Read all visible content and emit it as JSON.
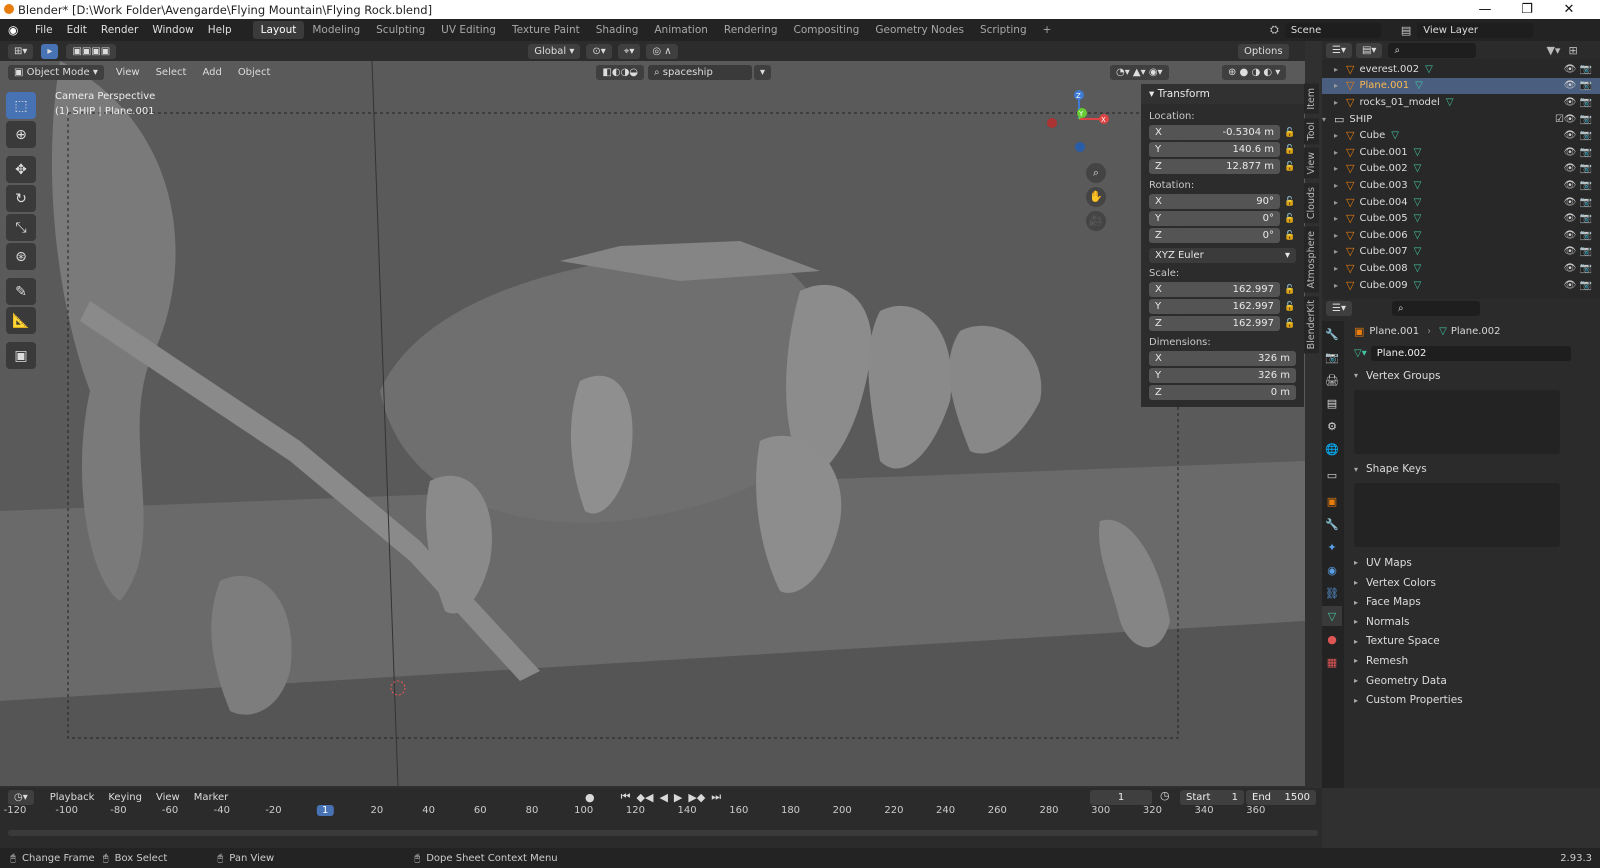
{
  "window": {
    "title": "Blender* [D:\\Work Folder\\Avengarde\\Flying Mountain\\Flying Rock.blend]",
    "min": "—",
    "max": "❐",
    "close": "✕"
  },
  "menu": [
    "File",
    "Edit",
    "Render",
    "Window",
    "Help"
  ],
  "workspaces": [
    {
      "label": "Layout",
      "active": true
    },
    {
      "label": "Modeling"
    },
    {
      "label": "Sculpting"
    },
    {
      "label": "UV Editing"
    },
    {
      "label": "Texture Paint"
    },
    {
      "label": "Shading"
    },
    {
      "label": "Animation"
    },
    {
      "label": "Rendering"
    },
    {
      "label": "Compositing"
    },
    {
      "label": "Geometry Nodes"
    },
    {
      "label": "Scripting"
    }
  ],
  "add_workspace": "+",
  "scene": "Scene",
  "view_layer": "View Layer",
  "viewport_header": {
    "orientation": "Global",
    "options": "Options",
    "mode": "Object Mode",
    "menus": [
      "View",
      "Select",
      "Add",
      "Object"
    ],
    "search_value": "spaceship"
  },
  "viewport": {
    "camera_label": "Camera Perspective",
    "object_label": "(1) SHIP | Plane.001"
  },
  "gizmo": {
    "z": "Z",
    "y": "Y",
    "x": "X"
  },
  "npanel": {
    "title": "Transform",
    "location_label": "Location:",
    "location": [
      {
        "axis": "X",
        "value": "-0.5304 m"
      },
      {
        "axis": "Y",
        "value": "140.6 m"
      },
      {
        "axis": "Z",
        "value": "12.877 m"
      }
    ],
    "rotation_label": "Rotation:",
    "rotation": [
      {
        "axis": "X",
        "value": "90°"
      },
      {
        "axis": "Y",
        "value": "0°"
      },
      {
        "axis": "Z",
        "value": "0°"
      }
    ],
    "rotation_mode": "XYZ Euler",
    "scale_label": "Scale:",
    "scale": [
      {
        "axis": "X",
        "value": "162.997"
      },
      {
        "axis": "Y",
        "value": "162.997"
      },
      {
        "axis": "Z",
        "value": "162.997"
      }
    ],
    "dimensions_label": "Dimensions:",
    "dimensions": [
      {
        "axis": "X",
        "value": "326 m"
      },
      {
        "axis": "Y",
        "value": "326 m"
      },
      {
        "axis": "Z",
        "value": "0 m"
      }
    ]
  },
  "sidebar_tabs": [
    "Item",
    "Tool",
    "View",
    "Clouds",
    "Atmosphere",
    "BlenderKit"
  ],
  "outliner": [
    {
      "name": "everest.002",
      "indent": 1,
      "type": "mesh"
    },
    {
      "name": "Plane.001",
      "indent": 1,
      "type": "mesh",
      "selected": true
    },
    {
      "name": "rocks_01_model",
      "indent": 1,
      "type": "mesh"
    },
    {
      "name": "SHIP",
      "indent": 0,
      "type": "collection"
    },
    {
      "name": "Cube",
      "indent": 1,
      "type": "mesh"
    },
    {
      "name": "Cube.001",
      "indent": 1,
      "type": "mesh"
    },
    {
      "name": "Cube.002",
      "indent": 1,
      "type": "mesh"
    },
    {
      "name": "Cube.003",
      "indent": 1,
      "type": "mesh"
    },
    {
      "name": "Cube.004",
      "indent": 1,
      "type": "mesh"
    },
    {
      "name": "Cube.005",
      "indent": 1,
      "type": "mesh"
    },
    {
      "name": "Cube.006",
      "indent": 1,
      "type": "mesh"
    },
    {
      "name": "Cube.007",
      "indent": 1,
      "type": "mesh"
    },
    {
      "name": "Cube.008",
      "indent": 1,
      "type": "mesh"
    },
    {
      "name": "Cube.009",
      "indent": 1,
      "type": "mesh"
    }
  ],
  "properties": {
    "breadcrumb_object": "Plane.001",
    "breadcrumb_data": "Plane.002",
    "data_name": "Plane.002",
    "vertex_groups": "Vertex Groups",
    "shape_keys": "Shape Keys",
    "collapsed": [
      "UV Maps",
      "Vertex Colors",
      "Face Maps",
      "Normals",
      "Texture Space",
      "Remesh",
      "Geometry Data",
      "Custom Properties"
    ]
  },
  "timeline": {
    "menus": [
      "Playback",
      "Keying",
      "View",
      "Marker"
    ],
    "current_frame": "1",
    "start_label": "Start",
    "start": "1",
    "end_label": "End",
    "end": "1500",
    "ticks": [
      "-120",
      "-100",
      "-80",
      "-60",
      "-40",
      "-20",
      "1",
      "20",
      "40",
      "60",
      "80",
      "100",
      "120",
      "140",
      "160",
      "180",
      "200",
      "220",
      "240",
      "260",
      "280",
      "300",
      "320",
      "340",
      "360"
    ]
  },
  "status": {
    "change_frame": "Change Frame",
    "box_select": "Box Select",
    "pan_view": "Pan View",
    "context_menu": "Dope Sheet Context Menu",
    "version": "2.93.3"
  },
  "colors": {
    "accent": "#4772b3",
    "object_orange": "#e87d0d",
    "mesh_green": "#44c4a0",
    "viewport_bg": "#5e5e5e"
  }
}
